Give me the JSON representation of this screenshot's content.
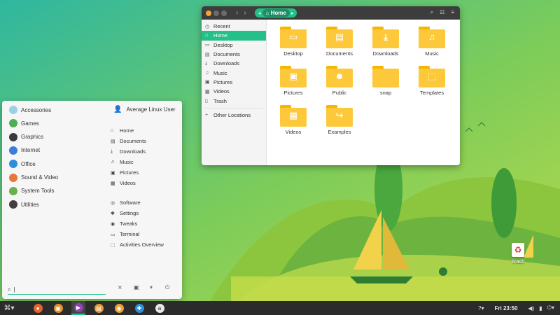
{
  "file_manager": {
    "location": "Home",
    "sidebar": [
      {
        "icon": "clock-icon",
        "glyph": "◷",
        "label": "Recent"
      },
      {
        "icon": "home-icon",
        "glyph": "⌂",
        "label": "Home",
        "active": true
      },
      {
        "icon": "desktop-icon",
        "glyph": "▭",
        "label": "Desktop"
      },
      {
        "icon": "document-icon",
        "glyph": "▤",
        "label": "Documents"
      },
      {
        "icon": "download-icon",
        "glyph": "⤓",
        "label": "Downloads"
      },
      {
        "icon": "music-icon",
        "glyph": "♫",
        "label": "Music"
      },
      {
        "icon": "picture-icon",
        "glyph": "▣",
        "label": "Pictures"
      },
      {
        "icon": "video-icon",
        "glyph": "▦",
        "label": "Videos"
      },
      {
        "icon": "trash-icon",
        "glyph": "▯",
        "label": "Trash"
      },
      {
        "icon": "plus-icon",
        "glyph": "+",
        "label": "Other Locations"
      }
    ],
    "folders": [
      {
        "label": "Desktop",
        "icon": "desktop-icon",
        "glyph": "▭"
      },
      {
        "label": "Documents",
        "icon": "document-icon",
        "glyph": "▤"
      },
      {
        "label": "Downloads",
        "icon": "download-icon",
        "glyph": "⤓"
      },
      {
        "label": "Music",
        "icon": "music-icon",
        "glyph": "♫"
      },
      {
        "label": "Pictures",
        "icon": "picture-icon",
        "glyph": "▣"
      },
      {
        "label": "Public",
        "icon": "people-icon",
        "glyph": "☻"
      },
      {
        "label": "snap",
        "icon": "folder-icon",
        "glyph": ""
      },
      {
        "label": "Templates",
        "icon": "template-icon",
        "glyph": "⬚"
      },
      {
        "label": "Videos",
        "icon": "video-icon",
        "glyph": "▦"
      },
      {
        "label": "Examples",
        "icon": "link-icon",
        "glyph": "↪"
      }
    ]
  },
  "menu": {
    "categories": [
      {
        "label": "Accessories",
        "icon": "accessories-icon",
        "color": "#9ad0e8"
      },
      {
        "label": "Games",
        "icon": "games-icon",
        "color": "#4caf50"
      },
      {
        "label": "Graphics",
        "icon": "graphics-icon",
        "color": "#3a3a3a"
      },
      {
        "label": "Internet",
        "icon": "internet-icon",
        "color": "#3b7dd8"
      },
      {
        "label": "Office",
        "icon": "office-icon",
        "color": "#2c8fdc"
      },
      {
        "label": "Sound & Video",
        "icon": "sound-video-icon",
        "color": "#e7783a"
      },
      {
        "label": "System Tools",
        "icon": "system-tools-icon",
        "color": "#6ab04c"
      },
      {
        "label": "Utilities",
        "icon": "utilities-icon",
        "color": "#404040"
      }
    ],
    "user": "Average Linux User",
    "places": [
      {
        "label": "Home",
        "icon": "home-icon",
        "glyph": "⌂"
      },
      {
        "label": "Documents",
        "icon": "document-icon",
        "glyph": "▤"
      },
      {
        "label": "Downloads",
        "icon": "download-icon",
        "glyph": "⤓"
      },
      {
        "label": "Music",
        "icon": "music-icon",
        "glyph": "♫"
      },
      {
        "label": "Pictures",
        "icon": "picture-icon",
        "glyph": "▣"
      },
      {
        "label": "Videos",
        "icon": "video-icon",
        "glyph": "▦"
      }
    ],
    "system": [
      {
        "label": "Software",
        "icon": "software-icon",
        "glyph": "◎"
      },
      {
        "label": "Settings",
        "icon": "settings-icon",
        "glyph": "✱"
      },
      {
        "label": "Tweaks",
        "icon": "tweaks-icon",
        "glyph": "◉"
      },
      {
        "label": "Terminal",
        "icon": "terminal-icon",
        "glyph": "▭"
      },
      {
        "label": "Activities Overview",
        "icon": "overview-icon",
        "glyph": "⬚"
      }
    ],
    "search_placeholder": ""
  },
  "desktop": {
    "trash_label": "Trash"
  },
  "taskbar": {
    "clock": "Fri 23:50",
    "apps": [
      {
        "icon": "firefox-icon",
        "color": "#e5632c",
        "glyph": "●"
      },
      {
        "icon": "toolbox-icon",
        "color": "#e58f2c",
        "glyph": "▣"
      },
      {
        "icon": "media-player-icon",
        "color": "#8e44ad",
        "glyph": "▶",
        "active": true
      },
      {
        "icon": "archive-icon",
        "color": "#e59a3a",
        "glyph": "▤"
      },
      {
        "icon": "disk-icon",
        "color": "#f0a030",
        "glyph": "◉"
      },
      {
        "icon": "help-icon",
        "color": "#2c8fdc",
        "glyph": "✚"
      },
      {
        "icon": "amazon-icon",
        "color": "#e8e8e8",
        "glyph": "a"
      }
    ]
  },
  "colors": {
    "accent": "#25c08a",
    "folder": "#fdc93b",
    "taskbar": "#2b2b2b"
  }
}
